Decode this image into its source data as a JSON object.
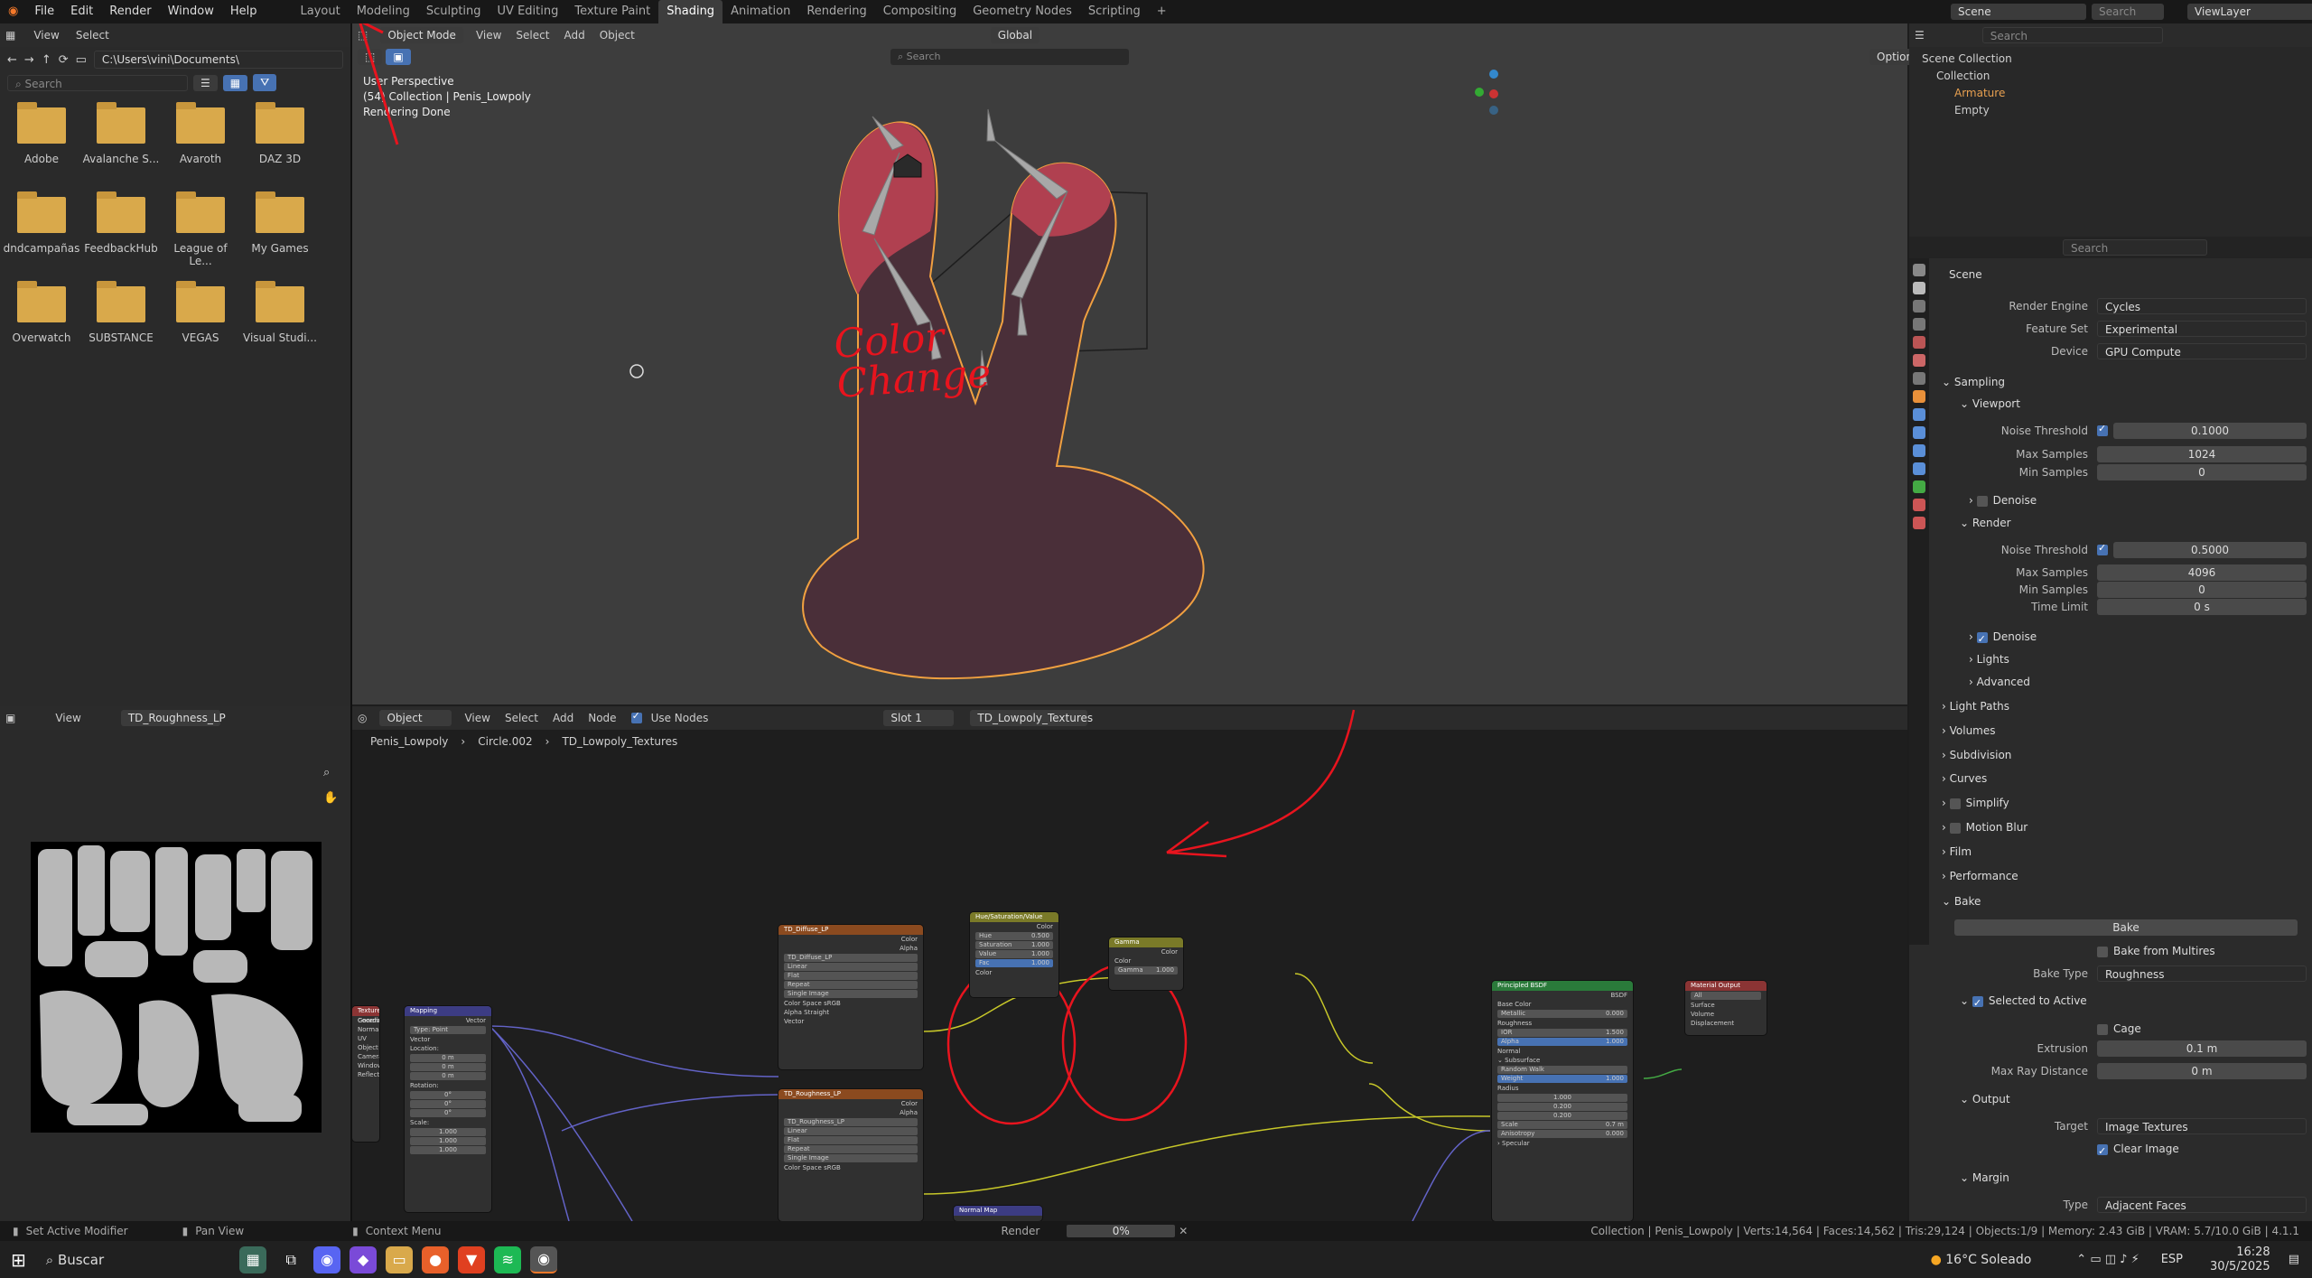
{
  "colors": {
    "accent": "#4772b3",
    "annotation": "#e8141e",
    "folder": "#d9a94b"
  },
  "menu": {
    "items": [
      "File",
      "Edit",
      "Render",
      "Window",
      "Help"
    ]
  },
  "workspaces": {
    "tabs": [
      "Layout",
      "Modeling",
      "Sculpting",
      "UV Editing",
      "Texture Paint",
      "Shading",
      "Animation",
      "Rendering",
      "Compositing",
      "Geometry Nodes",
      "Scripting"
    ],
    "active": "Shading",
    "add": "+"
  },
  "top_right": {
    "scene": "Scene",
    "view_layer": "ViewLayer",
    "search": "Search"
  },
  "file_browser": {
    "view": "View",
    "select": "Select",
    "path": "C:\\Users\\vini\\Documents\\",
    "search_placeholder": "Search",
    "folders": [
      {
        "name": "Adobe"
      },
      {
        "name": "Avalanche S..."
      },
      {
        "name": "Avaroth"
      },
      {
        "name": "DAZ 3D"
      },
      {
        "name": "dndcampañas"
      },
      {
        "name": "FeedbackHub"
      },
      {
        "name": "League of Le..."
      },
      {
        "name": "My Games"
      },
      {
        "name": "Overwatch"
      },
      {
        "name": "SUBSTANCE"
      },
      {
        "name": "VEGAS"
      },
      {
        "name": "Visual Studi..."
      }
    ]
  },
  "viewport": {
    "mode": "Object Mode",
    "menus": [
      "View",
      "Select",
      "Add",
      "Object"
    ],
    "orientation": "Global",
    "search": "Search",
    "options": "Options",
    "info": [
      "User Perspective",
      "(54) Collection | Penis_Lowpoly",
      "Rendering Done"
    ]
  },
  "annotation": {
    "text_line1": "Color",
    "text_line2": "Change"
  },
  "image_editor": {
    "view": "View",
    "image_name": "TD_Roughness_LP"
  },
  "node_editor": {
    "object": "Object",
    "menus": [
      "View",
      "Select",
      "Add",
      "Node"
    ],
    "use_nodes": "Use Nodes",
    "slot": "Slot 1",
    "material": "TD_Lowpoly_Textures",
    "breadcrumb": [
      "Penis_Lowpoly",
      "Circle.002",
      "TD_Lowpoly_Textures"
    ],
    "nodes": {
      "diffuse": {
        "title": "TD_Diffuse_LP",
        "outputs": [
          "Color",
          "Alpha"
        ],
        "image": "TD_Diffuse_LP",
        "options": [
          "Linear",
          "Flat",
          "Repeat",
          "Single Image"
        ],
        "color_space_label": "Color Space",
        "color_space": "sRGB",
        "alpha_label": "Alpha",
        "alpha": "Straight",
        "vector": "Vector"
      },
      "roughness": {
        "title": "TD_Roughness_LP",
        "outputs": [
          "Color",
          "Alpha"
        ],
        "image": "TD_Roughness_LP",
        "options": [
          "Linear",
          "Flat",
          "Repeat",
          "Single Image"
        ],
        "color_space_label": "Color Space",
        "color_space": "sRGB"
      },
      "hsv": {
        "title": "Hue/Saturation/Value",
        "output": "Color",
        "fields": [
          {
            "label": "Hue",
            "value": "0.500"
          },
          {
            "label": "Saturation",
            "value": "1.000"
          },
          {
            "label": "Value",
            "value": "1.000"
          },
          {
            "label": "Fac",
            "value": "1.000"
          }
        ],
        "input": "Color"
      },
      "gamma": {
        "title": "Gamma",
        "output": "Color",
        "input": "Color",
        "field_label": "Gamma",
        "field_value": "1.000"
      },
      "bsdf": {
        "title": "Principled BSDF",
        "output": "BSDF",
        "rows": [
          "Base Color"
        ],
        "fields": [
          {
            "label": "Metallic",
            "value": "0.000"
          },
          {
            "label": "Roughness",
            "value": ""
          },
          {
            "label": "IOR",
            "value": "1.500"
          },
          {
            "label": "Alpha",
            "value": "1.000"
          }
        ],
        "normal": "Normal",
        "subsurface": "Subsurface",
        "method": "Random Walk",
        "weight_label": "Weight",
        "weight": "1.000",
        "radius": "Radius",
        "radius_values": [
          "1.000",
          "0.200",
          "0.200"
        ],
        "scale_label": "Scale",
        "scale": "0.7 m",
        "aniso_label": "Anisotropy",
        "aniso": "0.000",
        "specular": "Specular"
      },
      "output": {
        "title": "Material Output",
        "target": "All",
        "inputs": [
          "Surface",
          "Volume",
          "Displacement"
        ]
      },
      "mapping": {
        "title": "Mapping",
        "output": "Vector",
        "type_label": "Type:",
        "type": "Point",
        "vector": "Vector",
        "location": "Location:",
        "loc": [
          "0 m",
          "0 m",
          "0 m"
        ],
        "rotation": "Rotation:",
        "rot": [
          "0°",
          "0°",
          "0°"
        ],
        "scale": "Scale:",
        "scl": [
          "1.000",
          "1.000",
          "1.000"
        ]
      },
      "texcoord": {
        "title": "Texture Coordinate",
        "outputs": [
          "Generated",
          "Normal",
          "UV",
          "Object",
          "Camera",
          "Window",
          "Reflection"
        ]
      },
      "normalmap": {
        "title": "Normal Map"
      }
    }
  },
  "outliner": {
    "scene_collection": "Scene Collection",
    "collection": "Collection",
    "items": [
      "Armature",
      "Empty"
    ],
    "search": "Search"
  },
  "properties": {
    "search": "Search",
    "scene": "Scene",
    "render_engine": {
      "label": "Render Engine",
      "value": "Cycles"
    },
    "feature_set": {
      "label": "Feature Set",
      "value": "Experimental"
    },
    "device": {
      "label": "Device",
      "value": "GPU Compute"
    },
    "sampling": "Sampling",
    "viewport": "Viewport",
    "vp_noise": {
      "label": "Noise Threshold",
      "value": "0.1000"
    },
    "vp_max": {
      "label": "Max Samples",
      "value": "1024"
    },
    "vp_min": {
      "label": "Min Samples",
      "value": "0"
    },
    "denoise": "Denoise",
    "render": "Render",
    "r_noise": {
      "label": "Noise Threshold",
      "value": "0.5000"
    },
    "r_max": {
      "label": "Max Samples",
      "value": "4096"
    },
    "r_min": {
      "label": "Min Samples",
      "value": "0"
    },
    "r_time": {
      "label": "Time Limit",
      "value": "0 s"
    },
    "lights": "Lights",
    "advanced": "Advanced",
    "panels": [
      "Light Paths",
      "Volumes",
      "Subdivision",
      "Curves",
      "Simplify",
      "Motion Blur",
      "Film",
      "Performance",
      "Bake"
    ],
    "bake_button": "Bake",
    "bake_multires": "Bake from Multires",
    "bake_type": {
      "label": "Bake Type",
      "value": "Roughness"
    },
    "selected_active": "Selected to Active",
    "cage": "Cage",
    "extrusion": {
      "label": "Extrusion",
      "value": "0.1 m"
    },
    "max_ray": {
      "label": "Max Ray Distance",
      "value": "0 m"
    },
    "output": "Output",
    "target": {
      "label": "Target",
      "value": "Image Textures"
    },
    "clear_image": "Clear Image",
    "margin": "Margin",
    "margin_type": {
      "label": "Type",
      "value": "Adjacent Faces"
    }
  },
  "statusbar": {
    "left": [
      "Set Active Modifier",
      "Pan View",
      "Context Menu"
    ],
    "render_label": "Render",
    "progress_text": "0%",
    "progress": 0,
    "stats": "Collection | Penis_Lowpoly | Verts:14,564 | Faces:14,562 | Tris:29,124 | Objects:1/9 | Memory: 2.43 GiB | VRAM: 5.7/10.0 GiB | 4.1.1"
  },
  "taskbar": {
    "search": "Buscar",
    "weather": "16°C  Soleado",
    "lang": "ESP",
    "time": "16:28",
    "date": "30/5/2025"
  }
}
